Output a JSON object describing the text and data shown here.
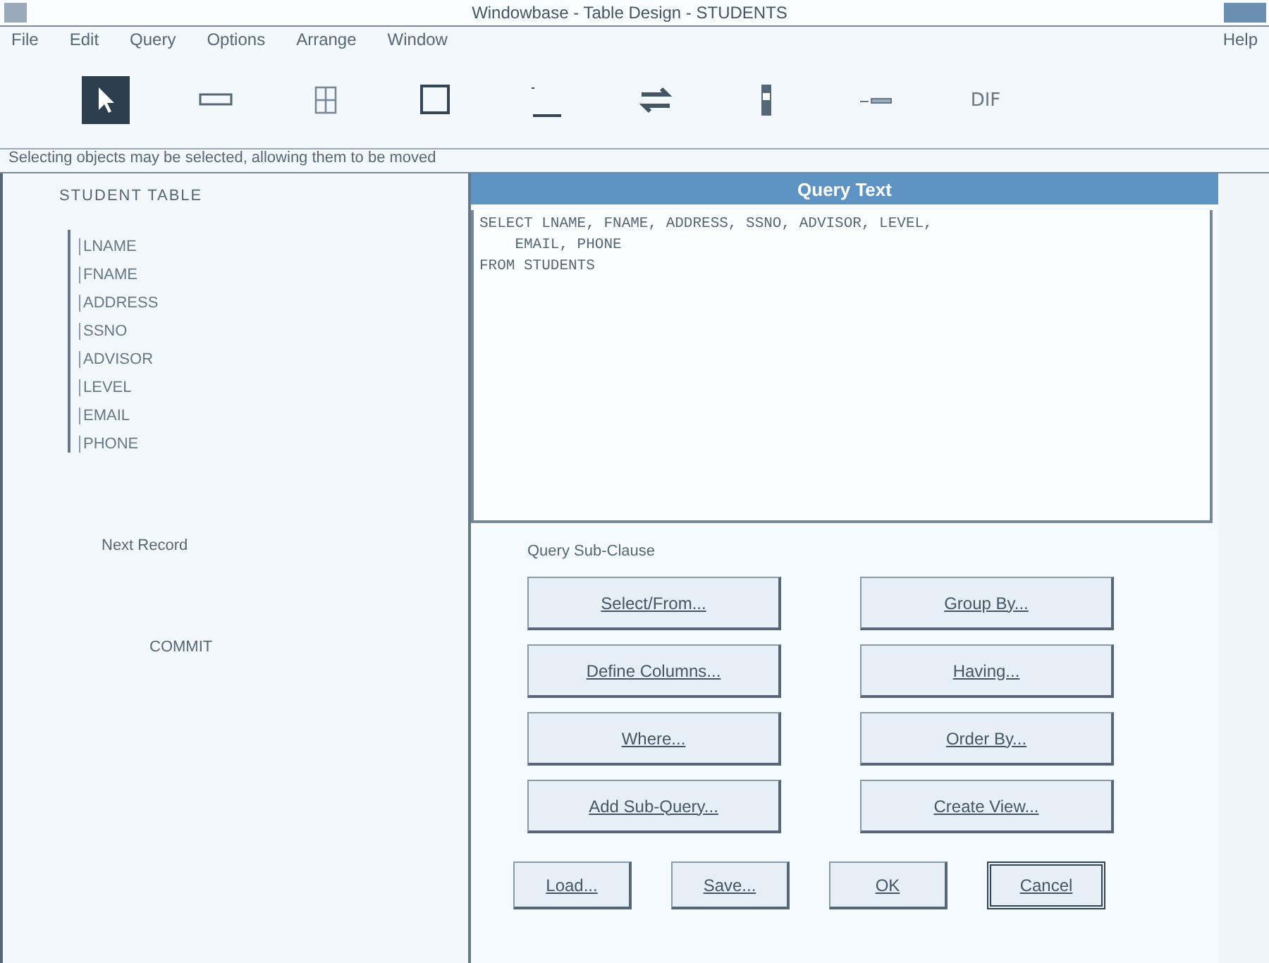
{
  "window": {
    "title": "Windowbase - Table Design - STUDENTS"
  },
  "menu": [
    {
      "label": "File"
    },
    {
      "label": "Edit"
    },
    {
      "label": "Query"
    },
    {
      "label": "Options"
    },
    {
      "label": "Arrange"
    },
    {
      "label": "Window"
    },
    {
      "label": "Help"
    }
  ],
  "toolbar": [
    {
      "kind": "pointer",
      "selected": true
    },
    {
      "kind": "field",
      "selected": false
    },
    {
      "kind": "grid",
      "selected": false
    },
    {
      "kind": "box",
      "selected": false
    },
    {
      "kind": "line",
      "selected": false
    },
    {
      "kind": "arrows",
      "selected": false
    },
    {
      "kind": "scroll",
      "selected": false
    },
    {
      "kind": "wave",
      "selected": false
    },
    {
      "kind": "label",
      "label": "DIF",
      "selected": false
    }
  ],
  "status": "Selecting objects may be selected, allowing them to be moved",
  "table": {
    "name": "STUDENT TABLE",
    "fields": [
      "LNAME",
      "FNAME",
      "ADDRESS",
      "SSNO",
      "ADVISOR",
      "LEVEL",
      "EMAIL",
      "PHONE"
    ]
  },
  "form_labels": [
    "Next Record",
    "COMMIT"
  ],
  "dialog": {
    "title": "Query Text",
    "query_lines": [
      "SELECT LNAME, FNAME, ADDRESS, SSNO, ADVISOR, LEVEL,",
      "    EMAIL, PHONE",
      "FROM STUDENTS"
    ],
    "section_label": "Query Sub-Clause",
    "clause_buttons": [
      "Select/From...",
      "Group By...",
      "Define Columns...",
      "Having...",
      "Where...",
      "Order By...",
      "Add Sub-Query...",
      "Create View..."
    ],
    "buttons": [
      {
        "label": "Load...",
        "default": false
      },
      {
        "label": "Save...",
        "default": false
      },
      {
        "label": "OK",
        "default": false
      },
      {
        "label": "Cancel",
        "default": true
      }
    ]
  }
}
